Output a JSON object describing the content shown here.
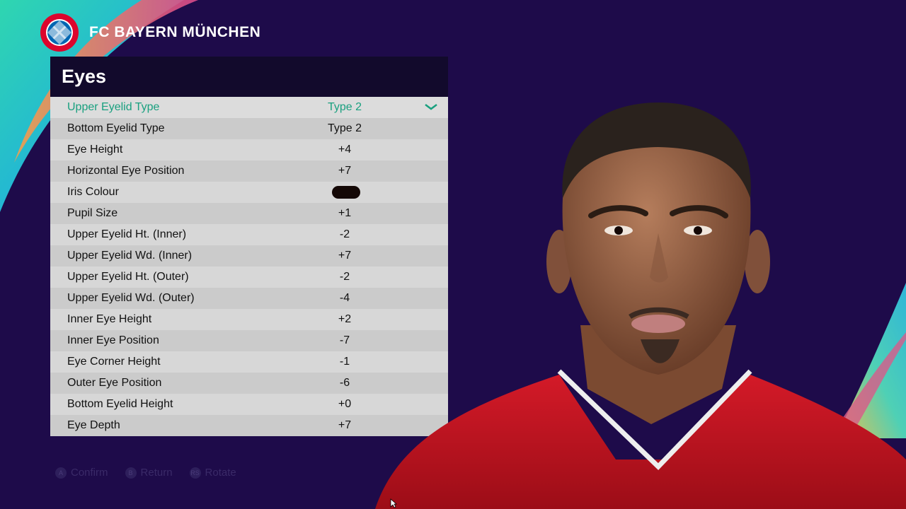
{
  "header": {
    "club_name": "FC BAYERN MÜNCHEN",
    "crest_icon": "bayern-crest-icon"
  },
  "panel": {
    "title": "Eyes",
    "rows": [
      {
        "label": "Upper Eyelid Type",
        "value": "Type 2"
      },
      {
        "label": "Bottom Eyelid Type",
        "value": "Type 2"
      },
      {
        "label": "Eye Height",
        "value": "+4"
      },
      {
        "label": "Horizontal Eye Position",
        "value": "+7"
      },
      {
        "label": "Iris Colour",
        "value": "",
        "swatch": "#140806"
      },
      {
        "label": "Pupil Size",
        "value": "+1"
      },
      {
        "label": "Upper Eyelid Ht. (Inner)",
        "value": "-2"
      },
      {
        "label": "Upper Eyelid Wd. (Inner)",
        "value": "+7"
      },
      {
        "label": "Upper Eyelid Ht. (Outer)",
        "value": "-2"
      },
      {
        "label": "Upper Eyelid Wd. (Outer)",
        "value": "-4"
      },
      {
        "label": "Inner Eye Height",
        "value": "+2"
      },
      {
        "label": "Inner Eye Position",
        "value": "-7"
      },
      {
        "label": "Eye Corner Height",
        "value": "-1"
      },
      {
        "label": "Outer Eye Position",
        "value": "-6"
      },
      {
        "label": "Bottom Eyelid Height",
        "value": "+0"
      },
      {
        "label": "Eye Depth",
        "value": "+7"
      }
    ]
  },
  "footer": {
    "confirm_glyph": "A",
    "confirm_label": "Confirm",
    "return_glyph": "B",
    "return_label": "Return",
    "rotate_glyph": "RS",
    "rotate_label": "Rotate"
  },
  "colors": {
    "accent": "#19a07f",
    "background": "#1e0b4a",
    "panel_header": "#120a2c"
  }
}
